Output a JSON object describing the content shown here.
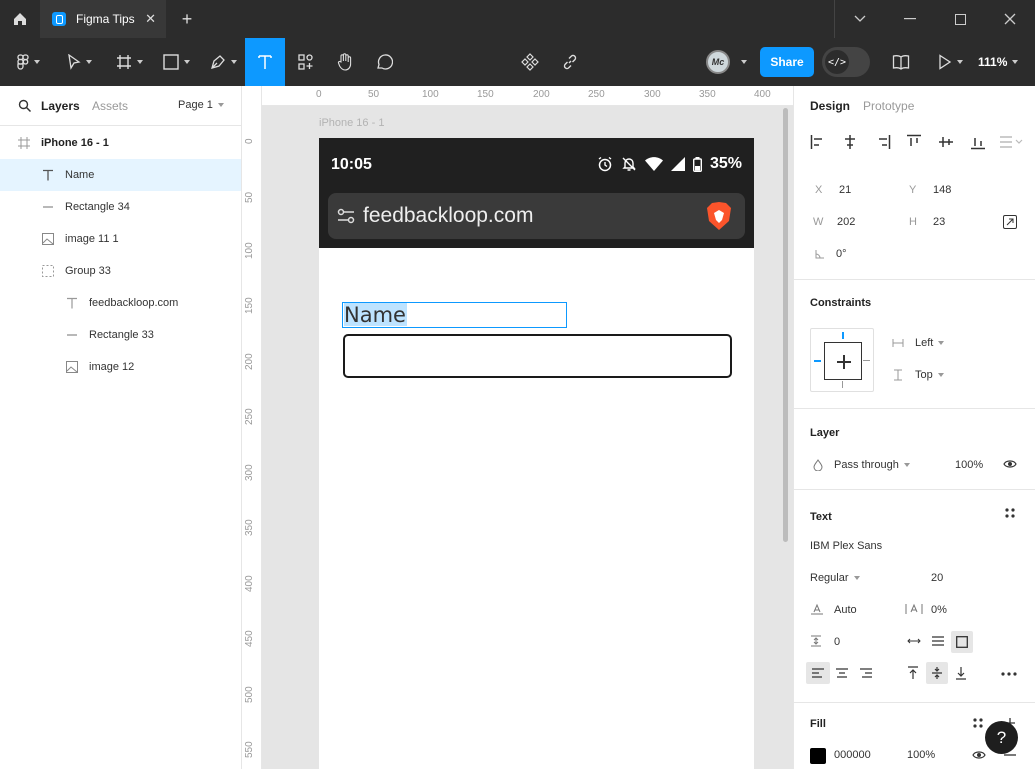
{
  "titlebar": {
    "tab_title": "Figma Tips"
  },
  "toolbar": {
    "share_label": "Share",
    "zoom": "111%",
    "avatar_initials": "Mc"
  },
  "left_panel": {
    "tab_layers": "Layers",
    "tab_assets": "Assets",
    "page": "Page 1",
    "layers": [
      {
        "name": "iPhone 16 - 1",
        "icon": "frame-icon"
      },
      {
        "name": "Name",
        "icon": "text-icon"
      },
      {
        "name": "Rectangle 34",
        "icon": "line-icon"
      },
      {
        "name": "image 11 1",
        "icon": "image-icon"
      },
      {
        "name": "Group 33",
        "icon": "group-icon"
      },
      {
        "name": "feedbackloop.com",
        "icon": "text-icon"
      },
      {
        "name": "Rectangle 33",
        "icon": "line-icon"
      },
      {
        "name": "image 12",
        "icon": "image-icon"
      }
    ]
  },
  "canvas": {
    "ruler_x": [
      "0",
      "50",
      "100",
      "150",
      "200",
      "250",
      "300",
      "350",
      "400"
    ],
    "ruler_y": [
      "0",
      "50",
      "100",
      "150",
      "200",
      "250",
      "300",
      "350",
      "400",
      "450",
      "500",
      "550"
    ],
    "frame_label": "iPhone 16 - 1",
    "status_time": "10:05",
    "battery": "35%",
    "url": "feedbackloop.com",
    "name_text": "Name"
  },
  "right_panel": {
    "tab_design": "Design",
    "tab_prototype": "Prototype",
    "x_label": "X",
    "x": "21",
    "y_label": "Y",
    "y": "148",
    "w_label": "W",
    "w": "202",
    "h_label": "H",
    "h": "23",
    "rotation": "0°",
    "constraints_title": "Constraints",
    "constraint_h": "Left",
    "constraint_v": "Top",
    "layer_title": "Layer",
    "blend": "Pass through",
    "opacity": "100%",
    "text_title": "Text",
    "font_family": "IBM Plex Sans",
    "font_weight": "Regular",
    "font_size": "20",
    "line_height": "Auto",
    "letter_spacing": "0%",
    "paragraph_spacing": "0",
    "fill_title": "Fill",
    "fill_hex": "000000",
    "fill_opacity": "100%"
  },
  "colors": {
    "accent": "#0d99ff",
    "toolbar_bg": "#2c2c2c",
    "selection_bg": "#e5f4ff",
    "highlight": "#bde3ff"
  }
}
